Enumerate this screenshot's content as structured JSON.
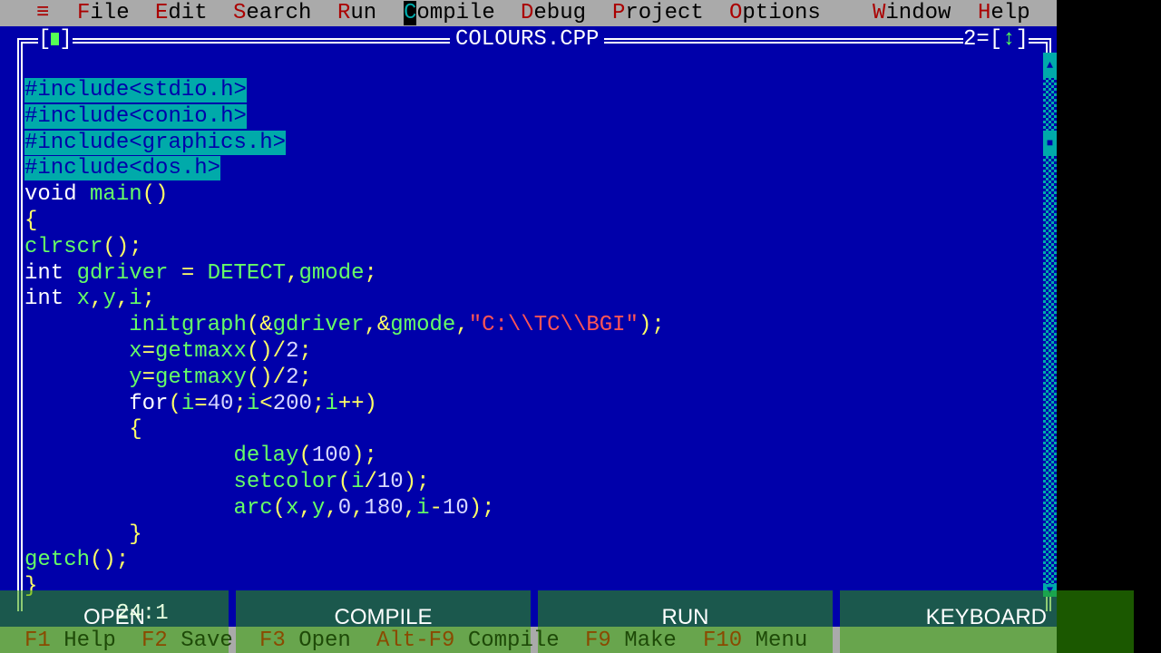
{
  "menu": {
    "system": "≡",
    "items": [
      {
        "hotkey": "F",
        "rest": "ile"
      },
      {
        "hotkey": "E",
        "rest": "dit"
      },
      {
        "hotkey": "S",
        "rest": "earch"
      },
      {
        "hotkey": "R",
        "rest": "un"
      },
      {
        "hotkey": "C",
        "rest": "ompile"
      },
      {
        "hotkey": "D",
        "rest": "ebug"
      },
      {
        "hotkey": "P",
        "rest": "roject"
      },
      {
        "hotkey": "O",
        "rest": "ptions"
      },
      {
        "hotkey": "W",
        "rest": "indow"
      },
      {
        "hotkey": "H",
        "rest": "elp"
      }
    ]
  },
  "window": {
    "title": "COLOURS.CPP",
    "number": "2",
    "close_open": "[",
    "close_close": "]",
    "zoom_open": "=[",
    "zoom_icon": "↕",
    "zoom_close": "]"
  },
  "editor": {
    "cursor_position": "24:1",
    "lines": [
      "#include<stdio.h>",
      "#include<conio.h>",
      "#include<graphics.h>",
      "#include<dos.h>",
      "void main()",
      "{",
      "clrscr();",
      "int gdriver = DETECT,gmode;",
      "int x,y,i;",
      "        initgraph(&gdriver,&gmode,\"C:\\\\TC\\\\BGI\");",
      "        x=getmaxx()/2;",
      "        y=getmaxy()/2;",
      "        for(i=40;i<200;i++)",
      "        {",
      "                delay(100);",
      "                setcolor(i/10);",
      "                arc(x,y,0,180,i-10);",
      "        }",
      "getch();",
      "}"
    ],
    "selected_lines": [
      0,
      1,
      2,
      3
    ]
  },
  "fkeys": [
    {
      "key": "F1",
      "label": "Help"
    },
    {
      "key": "F2",
      "label": "Save"
    },
    {
      "key": "F3",
      "label": "Open"
    },
    {
      "key": "Alt-F9",
      "label": "Compile"
    },
    {
      "key": "F9",
      "label": "Make"
    },
    {
      "key": "F10",
      "label": "Menu"
    }
  ],
  "overlay_buttons": {
    "open": "OPEN",
    "compile": "COMPILE",
    "run": "RUN",
    "keyboard": "KEYBOARD"
  },
  "colors": {
    "background": "#0000aa",
    "menubar": "#aaaaaa",
    "hotkey": "#aa0000",
    "selection": "#00aaaa",
    "overlay": "#32a000"
  }
}
